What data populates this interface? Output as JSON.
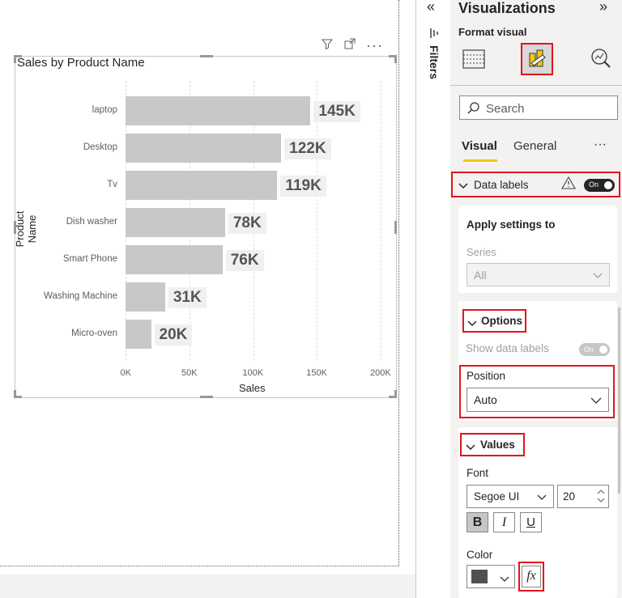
{
  "visual": {
    "title": "Sales by Product Name"
  },
  "chart_data": {
    "type": "bar",
    "orientation": "horizontal",
    "title": "Sales by Product Name",
    "xlabel": "Sales",
    "ylabel": "Product Name",
    "categories": [
      "laptop",
      "Desktop",
      "Tv",
      "Dish washer",
      "Smart Phone",
      "Washing Machine",
      "Micro-oven"
    ],
    "values": [
      145000,
      122000,
      119000,
      78000,
      76000,
      31000,
      20000
    ],
    "data_labels": [
      "145K",
      "122K",
      "119K",
      "78K",
      "76K",
      "31K",
      "20K"
    ],
    "xlim": [
      0,
      200000
    ],
    "xticks": [
      "0K",
      "50K",
      "100K",
      "150K",
      "200K"
    ],
    "bar_color": "#c8c8c8"
  },
  "pane": {
    "title": "Visualizations",
    "subtitle": "Format visual",
    "collapse_left": "«",
    "collapse_right": "»",
    "filters_label": "Filters",
    "search_placeholder": "Search",
    "tabs": {
      "visual": "Visual",
      "general": "General",
      "more": "···"
    },
    "data_labels": {
      "label": "Data labels",
      "toggle": "On"
    },
    "apply_settings": {
      "label": "Apply settings to",
      "series_label": "Series",
      "series_value": "All"
    },
    "options": {
      "label": "Options",
      "show_data_labels": "Show data labels",
      "show_toggle": "On",
      "position_label": "Position",
      "position_value": "Auto"
    },
    "values": {
      "label": "Values",
      "font_label": "Font",
      "font_value": "Segoe UI",
      "font_size": "20",
      "bold": "B",
      "italic": "I",
      "underline": "U",
      "color_label": "Color",
      "fx": "fx"
    },
    "accent_color": "#f2c811",
    "highlight_color": "#e3141c"
  }
}
